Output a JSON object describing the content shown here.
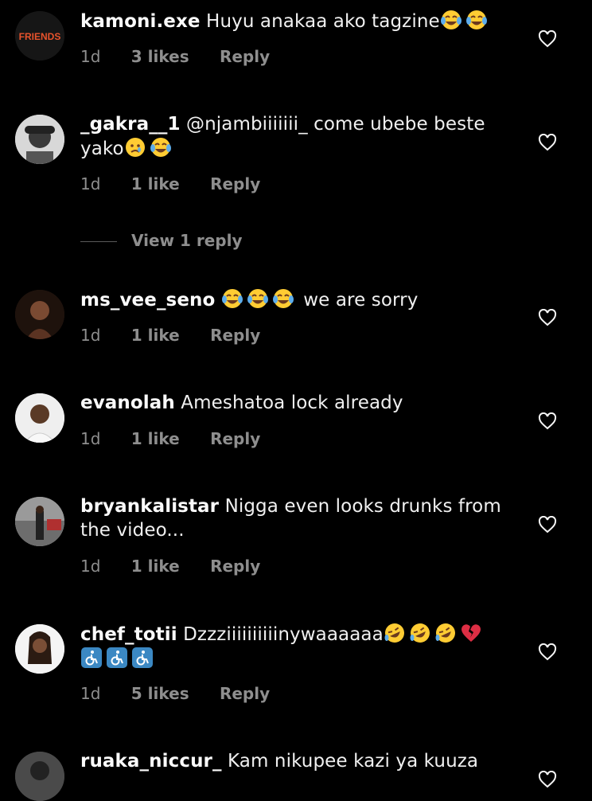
{
  "comments": [
    {
      "username": "kamoni.exe",
      "text": "Huyu anakaa ako tagzine",
      "emojis": [
        "laugh-cry",
        "laugh-cry"
      ],
      "time": "1d",
      "likes": "3 likes",
      "reply": "Reply",
      "avatar_label": "FRIENDS"
    },
    {
      "username": "_gakra__1",
      "text": "@njambiiiiiii_  come ubebe beste yako",
      "emojis": [
        "crying",
        "laugh-cry"
      ],
      "time": "1d",
      "likes": "1 like",
      "reply": "Reply"
    },
    {
      "username": "ms_vee_seno",
      "pre_emojis": [
        "laugh-cry",
        "laugh-cry",
        "laugh-cry"
      ],
      "text": "we are sorry",
      "time": "1d",
      "likes": "1 like",
      "reply": "Reply"
    },
    {
      "username": "evanolah",
      "text": "Ameshatoa lock already",
      "time": "1d",
      "likes": "1 like",
      "reply": "Reply"
    },
    {
      "username": "bryankalistar",
      "text": "Nigga even looks drunks from the video...",
      "time": "1d",
      "likes": "1 like",
      "reply": "Reply"
    },
    {
      "username": "chef_totii",
      "text": "Dzzziiiiiiiiiinywaaaaaa",
      "emojis": [
        "rofl",
        "rofl",
        "rofl",
        "broken-heart",
        "wheelchair",
        "wheelchair",
        "wheelchair"
      ],
      "time": "1d",
      "likes": "5 likes",
      "reply": "Reply"
    },
    {
      "username": "ruaka_niccur_",
      "text": "Kam nikupee kazi ya kuuza"
    }
  ],
  "view_replies": "View 1 reply",
  "colors": {
    "background": "#000000",
    "username": "#fafafa",
    "meta": "#8e8e8e",
    "emoji_face": "#ffcc33",
    "broken_heart": "#dd2e44",
    "wheelchair_bg": "#3b88c3"
  }
}
